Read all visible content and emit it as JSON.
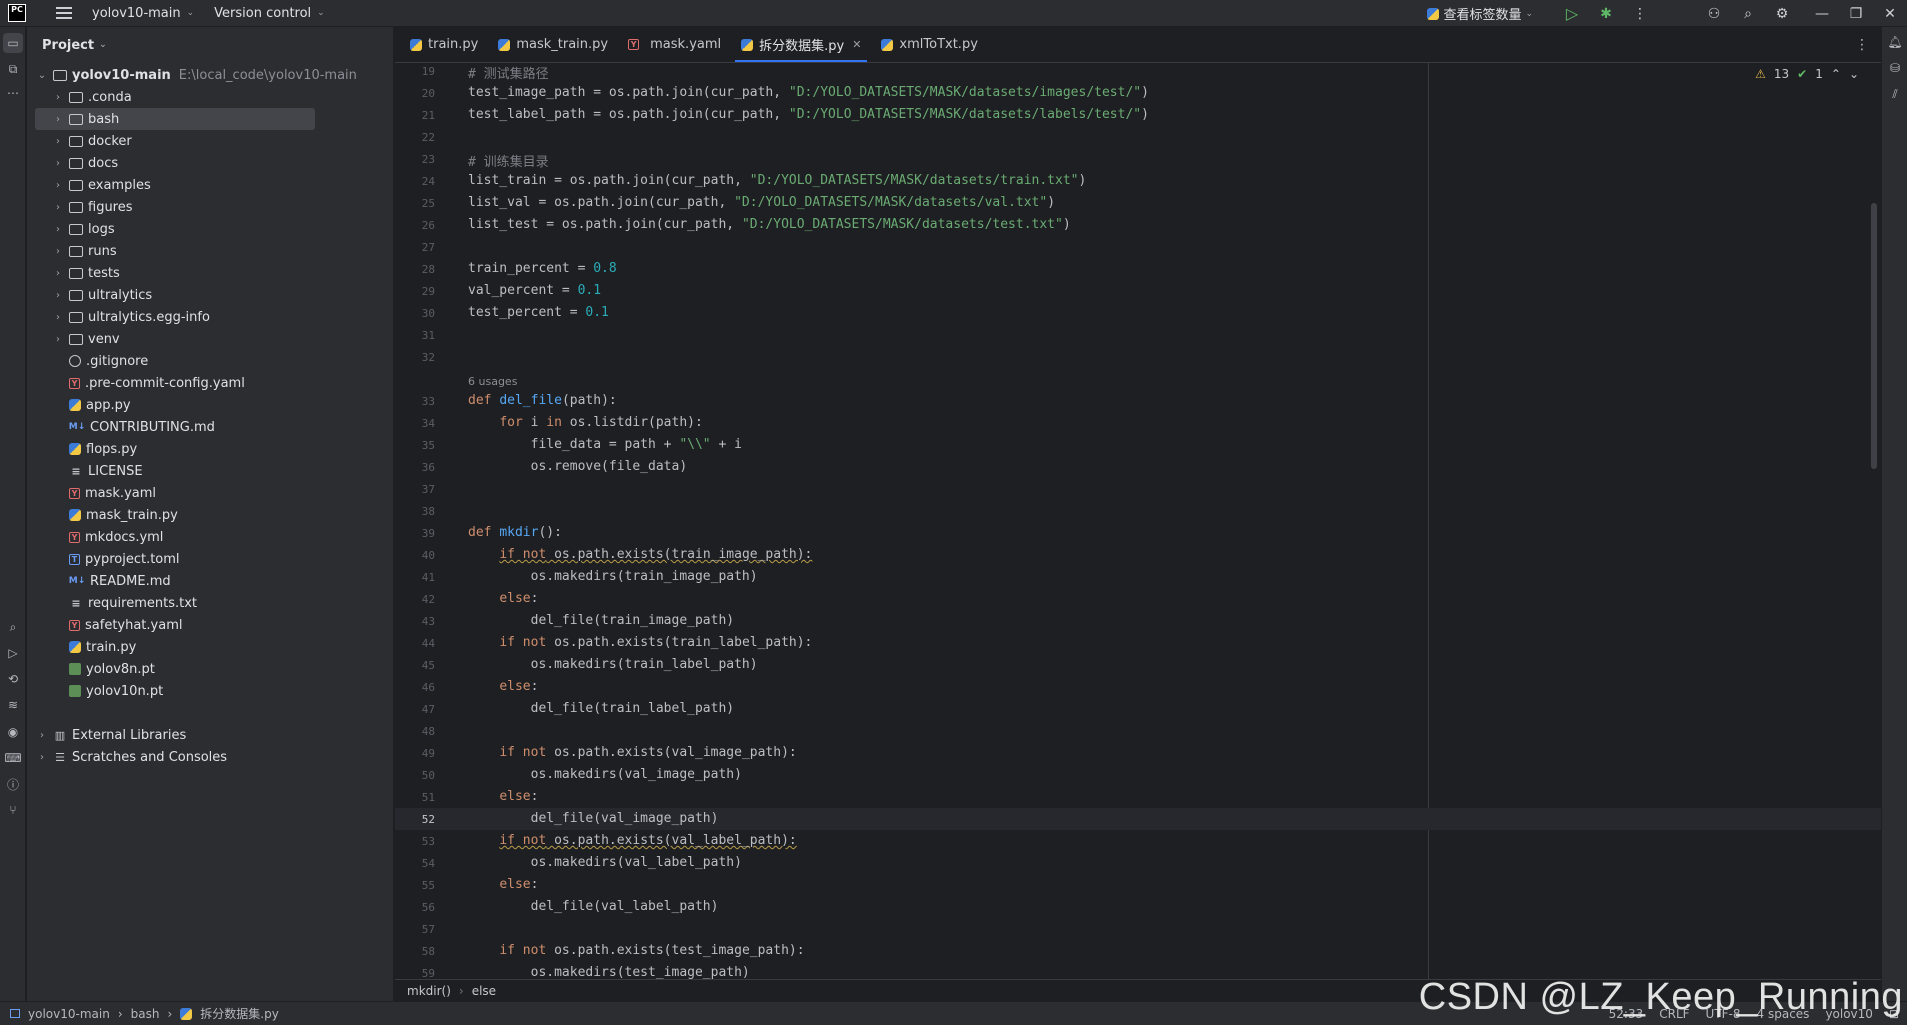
{
  "titlebar": {
    "app_logo": "PC",
    "project_name": "yolov10-main",
    "version_control": "Version control",
    "run_config": "查看标签数量"
  },
  "project_panel": {
    "title": "Project",
    "root": {
      "name": "yolov10-main",
      "path": "E:\\local_code\\yolov10-main"
    },
    "items": [
      {
        "name": ".conda",
        "type": "folder"
      },
      {
        "name": "bash",
        "type": "folder"
      },
      {
        "name": "docker",
        "type": "folder"
      },
      {
        "name": "docs",
        "type": "folder"
      },
      {
        "name": "examples",
        "type": "folder"
      },
      {
        "name": "figures",
        "type": "folder"
      },
      {
        "name": "logs",
        "type": "folder"
      },
      {
        "name": "runs",
        "type": "folder"
      },
      {
        "name": "tests",
        "type": "folder"
      },
      {
        "name": "ultralytics",
        "type": "folder"
      },
      {
        "name": "ultralytics.egg-info",
        "type": "folder"
      },
      {
        "name": "venv",
        "type": "folder"
      },
      {
        "name": ".gitignore",
        "type": "ignore"
      },
      {
        "name": ".pre-commit-config.yaml",
        "type": "yaml"
      },
      {
        "name": "app.py",
        "type": "py"
      },
      {
        "name": "CONTRIBUTING.md",
        "type": "md"
      },
      {
        "name": "flops.py",
        "type": "py"
      },
      {
        "name": "LICENSE",
        "type": "txt"
      },
      {
        "name": "mask.yaml",
        "type": "yaml"
      },
      {
        "name": "mask_train.py",
        "type": "py"
      },
      {
        "name": "mkdocs.yml",
        "type": "yaml"
      },
      {
        "name": "pyproject.toml",
        "type": "toml"
      },
      {
        "name": "README.md",
        "type": "md"
      },
      {
        "name": "requirements.txt",
        "type": "txt"
      },
      {
        "name": "safetyhat.yaml",
        "type": "yaml"
      },
      {
        "name": "train.py",
        "type": "py"
      },
      {
        "name": "yolov8n.pt",
        "type": "pt"
      },
      {
        "name": "yolov10n.pt",
        "type": "pt"
      }
    ],
    "external_libraries": "External Libraries",
    "scratches": "Scratches and Consoles"
  },
  "tabs": [
    {
      "label": "train.py"
    },
    {
      "label": "mask_train.py"
    },
    {
      "label": "mask.yaml"
    },
    {
      "label": "拆分数据集.py"
    },
    {
      "label": "xmlToTxt.py"
    }
  ],
  "inspections": {
    "warnings": "13",
    "ok": "1"
  },
  "editor": {
    "current_line": "52",
    "usages_label": "6 usages",
    "lines": [
      {
        "n": "19",
        "html": "<span class=\"cm\"># 测试集路径</span>"
      },
      {
        "n": "20",
        "html": "test_image_path = os.path.join(cur_path, <span class=\"str\">\"D:/YOLO_DATASETS/MASK/datasets/images/test/\"</span>)"
      },
      {
        "n": "21",
        "html": "test_label_path = os.path.join(cur_path, <span class=\"str\">\"D:/YOLO_DATASETS/MASK/datasets/labels/test/\"</span>)"
      },
      {
        "n": "22",
        "html": ""
      },
      {
        "n": "23",
        "html": "<span class=\"cm\"># 训练集目录</span>"
      },
      {
        "n": "24",
        "html": "list_train = os.path.join(cur_path, <span class=\"str\">\"D:/YOLO_DATASETS/MASK/datasets/train.txt\"</span>)"
      },
      {
        "n": "25",
        "html": "list_val = os.path.join(cur_path, <span class=\"str\">\"D:/YOLO_DATASETS/MASK/datasets/val.txt\"</span>)"
      },
      {
        "n": "26",
        "html": "list_test = os.path.join(cur_path, <span class=\"str\">\"D:/YOLO_DATASETS/MASK/datasets/test.txt\"</span>)"
      },
      {
        "n": "27",
        "html": ""
      },
      {
        "n": "28",
        "html": "train_percent = <span class=\"num\">0.8</span>"
      },
      {
        "n": "29",
        "html": "val_percent = <span class=\"num\">0.1</span>"
      },
      {
        "n": "30",
        "html": "test_percent = <span class=\"num\">0.1</span>"
      },
      {
        "n": "31",
        "html": ""
      },
      {
        "n": "32",
        "html": ""
      },
      {
        "n": "33",
        "html": "<span class=\"kw\">def</span> <span class=\"fn\">del_file</span>(path):"
      },
      {
        "n": "34",
        "html": "    <span class=\"kw\">for</span> i <span class=\"kw\">in</span> os.listdir(path):"
      },
      {
        "n": "35",
        "html": "        file_data = path + <span class=\"str\">\"\\\\\"</span> + i"
      },
      {
        "n": "36",
        "html": "        os.remove(file_data)"
      },
      {
        "n": "37",
        "html": ""
      },
      {
        "n": "38",
        "html": ""
      },
      {
        "n": "39",
        "html": "<span class=\"kw\">def</span> <span class=\"fn\">mkdir</span>():"
      },
      {
        "n": "40",
        "html": "    <span class=\"warn-ul\"><span class=\"kw\">if not</span> os.path.exists(train_image_path):</span>"
      },
      {
        "n": "41",
        "html": "        os.makedirs(train_image_path)"
      },
      {
        "n": "42",
        "html": "    <span class=\"kw\">else</span>:"
      },
      {
        "n": "43",
        "html": "        del_file(train_image_path)"
      },
      {
        "n": "44",
        "html": "    <span class=\"kw\">if not</span> os.path.exists(train_label_path):"
      },
      {
        "n": "45",
        "html": "        os.makedirs(train_label_path)"
      },
      {
        "n": "46",
        "html": "    <span class=\"kw\">else</span>:"
      },
      {
        "n": "47",
        "html": "        del_file(train_label_path)"
      },
      {
        "n": "48",
        "html": ""
      },
      {
        "n": "49",
        "html": "    <span class=\"kw\">if not</span> os.path.exists(val_image_path):"
      },
      {
        "n": "50",
        "html": "        os.makedirs(val_image_path)"
      },
      {
        "n": "51",
        "html": "    <span class=\"kw\">else</span>:"
      },
      {
        "n": "52",
        "html": "        del_file(val_image_path)"
      },
      {
        "n": "53",
        "html": "    <span class=\"warn-ul\"><span class=\"kw\">if not</span> os.path.exists(val_label_path):</span>"
      },
      {
        "n": "54",
        "html": "        os.makedirs(val_label_path)"
      },
      {
        "n": "55",
        "html": "    <span class=\"kw\">else</span>:"
      },
      {
        "n": "56",
        "html": "        del_file(val_label_path)"
      },
      {
        "n": "57",
        "html": ""
      },
      {
        "n": "58",
        "html": "    <span class=\"kw\">if not</span> os.path.exists(test_image_path):"
      },
      {
        "n": "59",
        "html": "        os.makedirs(test_image_path)"
      }
    ]
  },
  "editor_breadcrumb": {
    "scope": "mkdir()",
    "block": "else"
  },
  "statusbar": {
    "crumb_project": "yolov10-main",
    "crumb_folder": "bash",
    "crumb_file": "拆分数据集.py",
    "position": "52:33",
    "line_sep": "CRLF",
    "encoding": "UTF-8",
    "indent": "4 spaces",
    "interpreter": "yolov10"
  },
  "watermark": "CSDN @LZ_Keep_Running",
  "colors": {
    "keyword": "#cf8e6d",
    "function": "#56a8f5",
    "string": "#6aab73",
    "number": "#2aacb8",
    "comment": "#7a7e85",
    "accent": "#3574f0"
  }
}
